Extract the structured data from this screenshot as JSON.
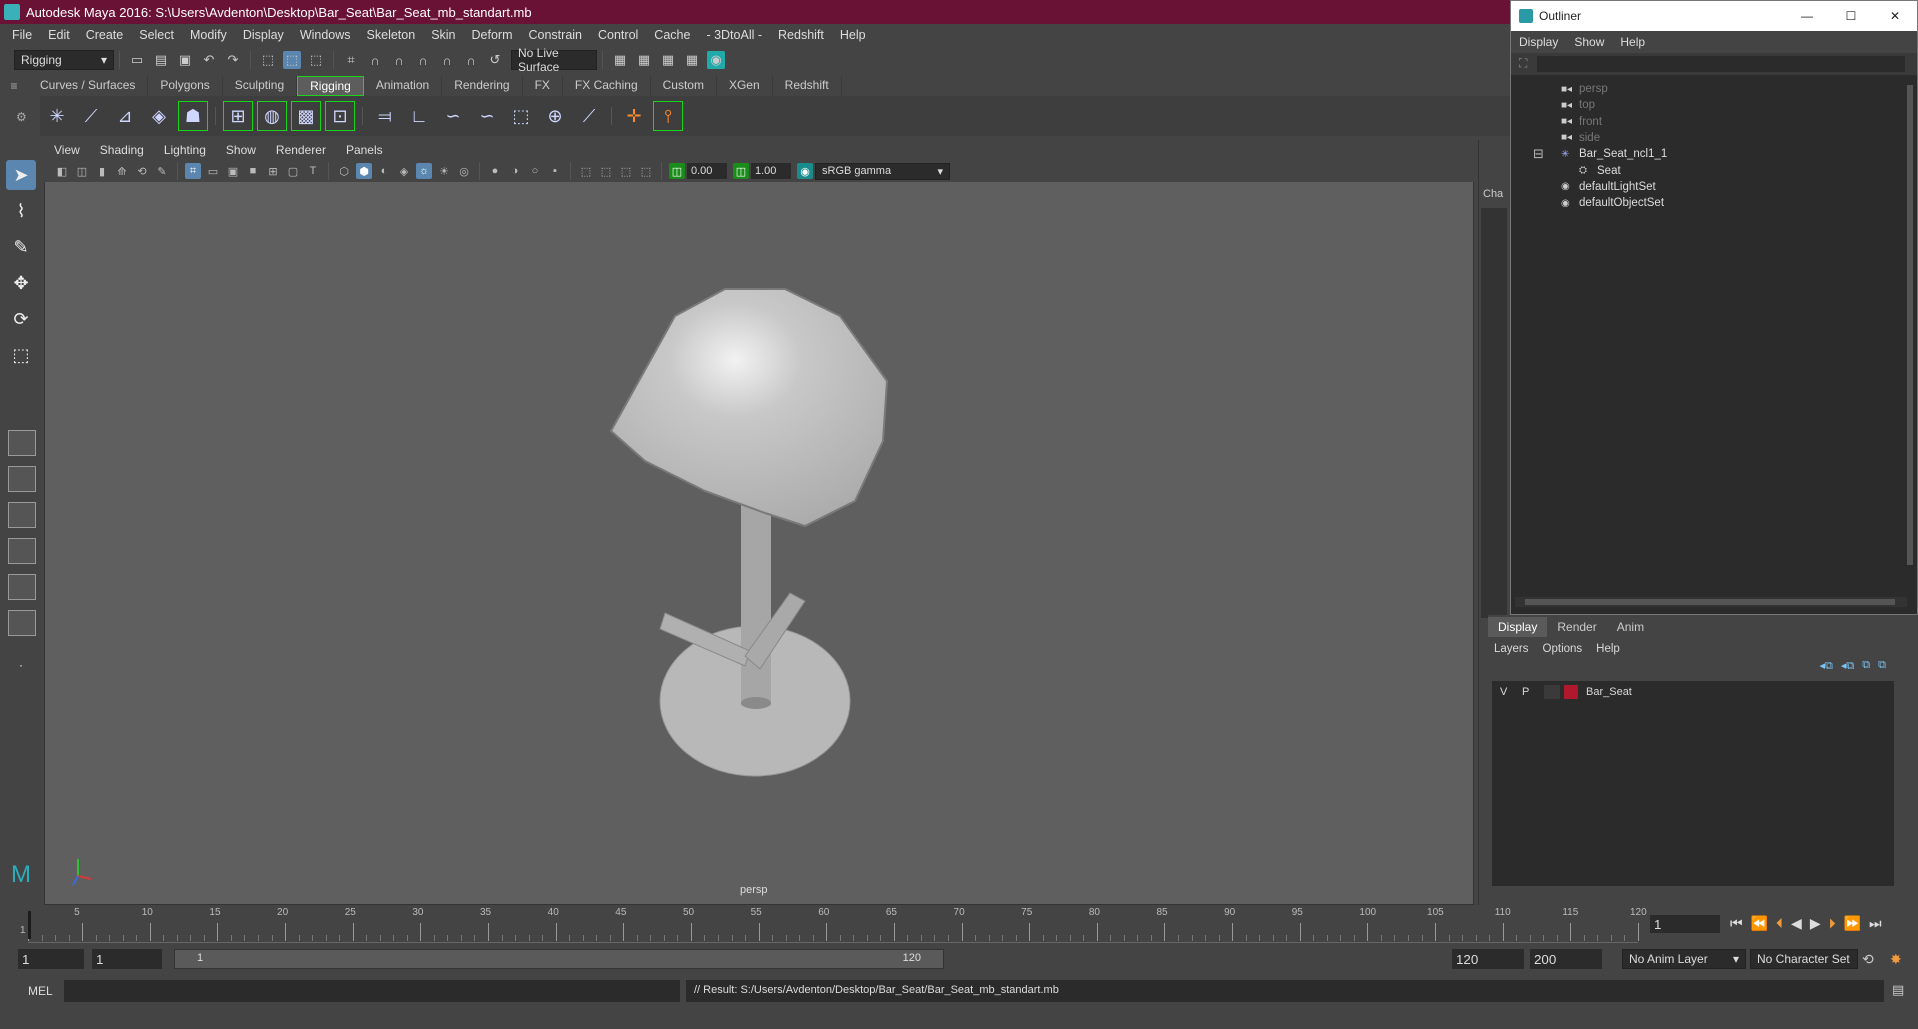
{
  "window": {
    "title": "Autodesk Maya 2016: S:\\Users\\Avdenton\\Desktop\\Bar_Seat\\Bar_Seat_mb_standart.mb"
  },
  "menubar": [
    "File",
    "Edit",
    "Create",
    "Select",
    "Modify",
    "Display",
    "Windows",
    "Skeleton",
    "Skin",
    "Deform",
    "Constrain",
    "Control",
    "Cache",
    "- 3DtoAll -",
    "Redshift",
    "Help"
  ],
  "statusline": {
    "menuset": "Rigging",
    "live_surface": "No Live Surface"
  },
  "shelf": {
    "tabs": [
      "Curves / Surfaces",
      "Polygons",
      "Sculpting",
      "Rigging",
      "Animation",
      "Rendering",
      "FX",
      "FX Caching",
      "Custom",
      "XGen",
      "Redshift"
    ],
    "active_tab": "Rigging"
  },
  "viewport": {
    "menu": [
      "View",
      "Shading",
      "Lighting",
      "Show",
      "Renderer",
      "Panels"
    ],
    "exposure": "0.00",
    "gamma": "1.00",
    "colorspace": "sRGB gamma",
    "camera": "persp"
  },
  "channel_strip": {
    "label": "Cha"
  },
  "outliner": {
    "title": "Outliner",
    "menu": [
      "Display",
      "Show",
      "Help"
    ],
    "items": [
      {
        "label": "persp",
        "indent": 1,
        "icon": "camera-icon",
        "dim": true
      },
      {
        "label": "top",
        "indent": 1,
        "icon": "camera-icon",
        "dim": true
      },
      {
        "label": "front",
        "indent": 1,
        "icon": "camera-icon",
        "dim": true
      },
      {
        "label": "side",
        "indent": 1,
        "icon": "camera-icon",
        "dim": true
      },
      {
        "label": "Bar_Seat_ncl1_1",
        "indent": 1,
        "icon": "group-icon",
        "dim": false,
        "expander": "−"
      },
      {
        "label": "Seat",
        "indent": 2,
        "icon": "mesh-icon",
        "dim": false
      },
      {
        "label": "defaultLightSet",
        "indent": 1,
        "icon": "set-icon",
        "dim": false
      },
      {
        "label": "defaultObjectSet",
        "indent": 1,
        "icon": "set-icon",
        "dim": false
      }
    ]
  },
  "layers": {
    "tabs": [
      "Display",
      "Render",
      "Anim"
    ],
    "active_tab": "Display",
    "menu": [
      "Layers",
      "Options",
      "Help"
    ],
    "rows": [
      {
        "v": "V",
        "p": "P",
        "color": "#b0182e",
        "name": "Bar_Seat"
      }
    ]
  },
  "timeline": {
    "ticks": [
      "1",
      "5",
      "10",
      "15",
      "20",
      "25",
      "30",
      "35",
      "40",
      "45",
      "50",
      "55",
      "60",
      "65",
      "70",
      "75",
      "80",
      "85",
      "90",
      "95",
      "100",
      "105",
      "110",
      "115",
      "120"
    ],
    "current_frame": "1"
  },
  "range": {
    "start": "1",
    "playback_start": "1",
    "slider_start": "1",
    "slider_end": "120",
    "playback_end": "120",
    "end": "200",
    "anim_layer": "No Anim Layer",
    "character_set": "No Character Set"
  },
  "cmdline": {
    "lang": "MEL",
    "result": "// Result: S:/Users/Avdenton/Desktop/Bar_Seat/Bar_Seat_mb_standart.mb"
  },
  "colors": {
    "title_bar": "#6a1236",
    "highlight": "#5a86b0",
    "shelf_outline": "#1ad41a"
  }
}
